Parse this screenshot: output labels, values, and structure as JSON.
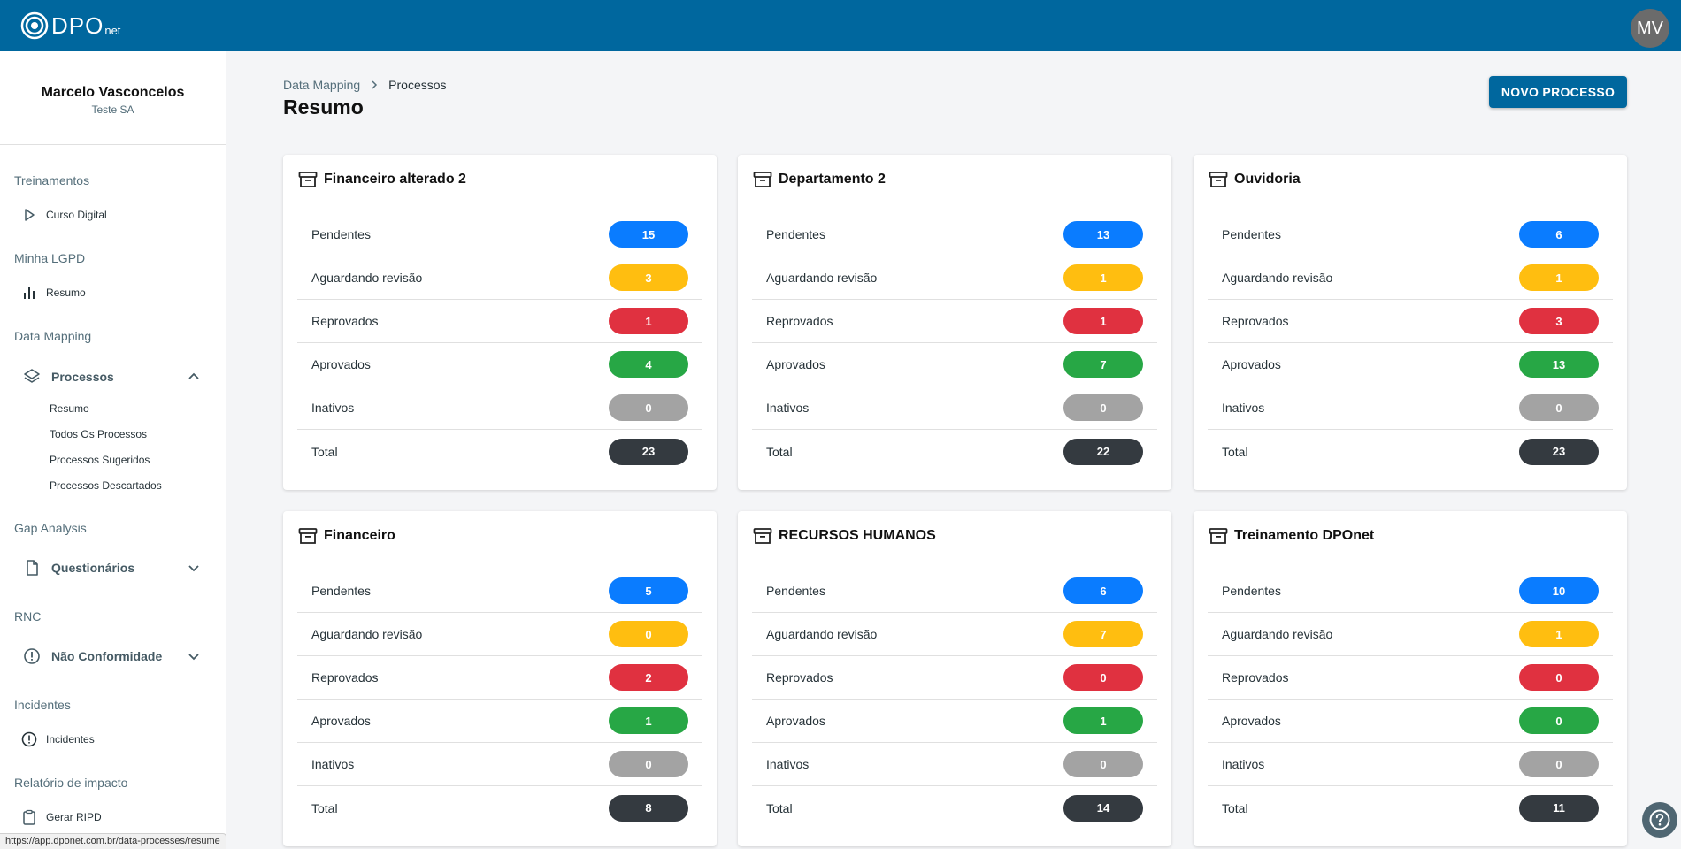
{
  "header": {
    "logo_text": "DPO",
    "logo_sub": "net",
    "avatar_initials": "MV"
  },
  "user": {
    "name": "Marcelo Vasconcelos",
    "company": "Teste SA"
  },
  "sidebar": {
    "sections": {
      "treinamentos": "Treinamentos",
      "minha_lgpd": "Minha LGPD",
      "data_mapping": "Data Mapping",
      "gap_analysis": "Gap Analysis",
      "rnc": "RNC",
      "incidentes": "Incidentes",
      "relatorio": "Relatório de impacto"
    },
    "items": {
      "curso_digital": "Curso Digital",
      "resumo": "Resumo",
      "processos": "Processos",
      "questionarios": "Questionários",
      "nao_conformidade": "Não Conformidade",
      "incidentes": "Incidentes",
      "gerar_ripd": "Gerar RIPD"
    },
    "processos_sub": [
      "Resumo",
      "Todos Os Processos",
      "Processos Sugeridos",
      "Processos Descartados"
    ]
  },
  "breadcrumb": {
    "parent": "Data Mapping",
    "current": "Processos"
  },
  "page_title": "Resumo",
  "new_button": "NOVO PROCESSO",
  "status_url": "https://app.dponet.com.br/data-processes/resume",
  "row_labels": [
    "Pendentes",
    "Aguardando revisão",
    "Reprovados",
    "Aprovados",
    "Inativos",
    "Total"
  ],
  "colors": {
    "pendentes": "#0a7cff",
    "aguardando": "#ffbe10",
    "reprovados": "#e03140",
    "aprovados": "#27a745",
    "inativos": "#a3a3a3",
    "total": "#343a40",
    "brand": "#00679e"
  },
  "departments": [
    {
      "name": "Financeiro alterado 2",
      "counts": [
        15,
        3,
        1,
        4,
        0,
        23
      ]
    },
    {
      "name": "Departamento 2",
      "counts": [
        13,
        1,
        1,
        7,
        0,
        22
      ]
    },
    {
      "name": "Ouvidoria",
      "counts": [
        6,
        1,
        3,
        13,
        0,
        23
      ]
    },
    {
      "name": "Financeiro",
      "counts": [
        5,
        0,
        2,
        1,
        0,
        8
      ]
    },
    {
      "name": "RECURSOS HUMANOS",
      "counts": [
        6,
        7,
        0,
        1,
        0,
        14
      ]
    },
    {
      "name": "Treinamento DPOnet",
      "counts": [
        10,
        1,
        0,
        0,
        0,
        11
      ]
    }
  ]
}
